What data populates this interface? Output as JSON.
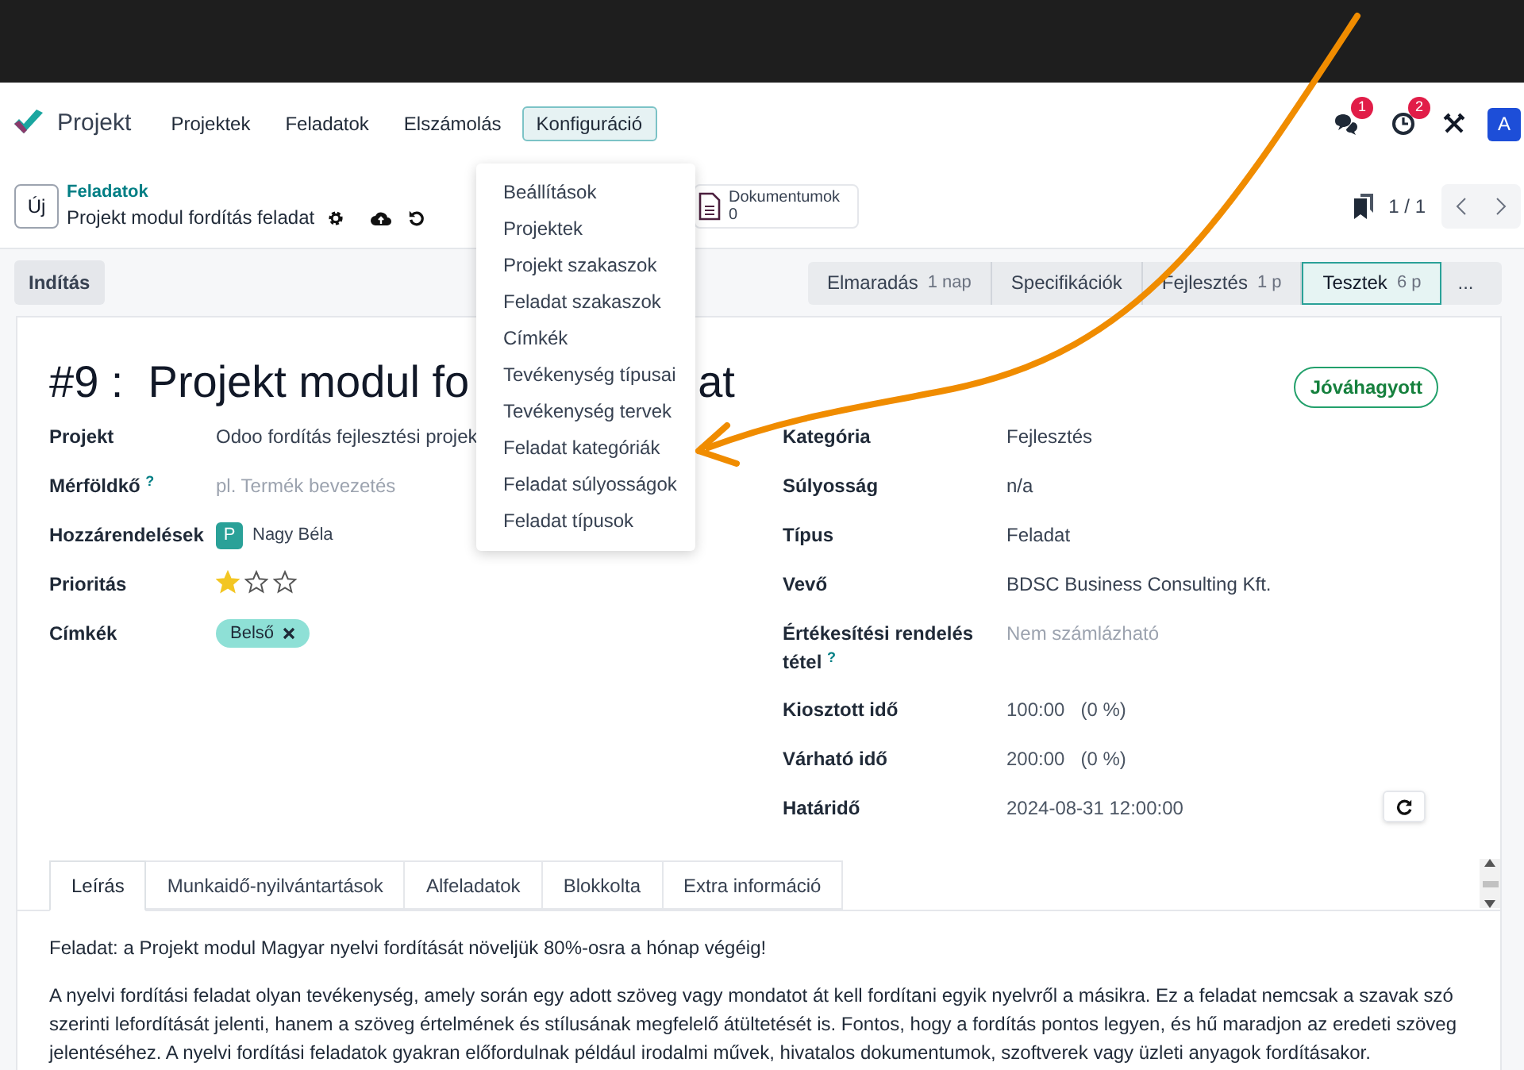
{
  "app": {
    "name": "Projekt"
  },
  "menu": [
    {
      "label": "Projektek",
      "selected": false
    },
    {
      "label": "Feladatok",
      "selected": false
    },
    {
      "label": "Elszámolás",
      "selected": false
    },
    {
      "label": "Konfiguráció",
      "selected": true
    }
  ],
  "dropdown": [
    "Beállítások",
    "Projektek",
    "Projekt szakaszok",
    "Feladat szakaszok",
    "Címkék",
    "Tevékenység típusai",
    "Tevékenység tervek",
    "Feladat kategóriák",
    "Feladat súlyosságok",
    "Feladat típusok"
  ],
  "systray": {
    "messages_badge": "1",
    "activities_badge": "2",
    "avatar": "A"
  },
  "control_panel": {
    "new_button": "Új",
    "breadcrumb": "Feladatok",
    "record": "Projekt modul fordítás feladat",
    "documents_label": "Dokumentumok",
    "documents_count": "0",
    "pager": "1 / 1"
  },
  "action_button": "Indítás",
  "stages": [
    {
      "label": "Elmaradás",
      "duration": "1 nap",
      "selected": false
    },
    {
      "label": "Specifikációk",
      "selected": false
    },
    {
      "label": "Fejlesztés",
      "duration": "1 p",
      "selected": false
    },
    {
      "label": "Tesztek",
      "duration": "6 p",
      "selected": true
    }
  ],
  "stages_more": "...",
  "form": {
    "title_visible": "#9 :  Projekt modul fo",
    "title_tail": "at",
    "state_button": "Jóváhagyott",
    "left_fields": [
      {
        "kind": "text",
        "label": "Projekt",
        "value": "Odoo fordítás fejlesztési projek"
      },
      {
        "kind": "placeholder",
        "label": "Mérföldkő $^{?}$",
        "placeholder": "pl. Termék bevezetés"
      },
      {
        "kind": "user",
        "label": "Hozzárendelések",
        "avatar": "P",
        "value": "Nagy Béla"
      },
      {
        "kind": "stars",
        "label": "Prioritás",
        "stars": 1
      },
      {
        "kind": "tags",
        "label": "Címkék",
        "tags": [
          {
            "label": "Belső",
            "color": "#8ee0d6"
          }
        ]
      }
    ],
    "right_fields": [
      {
        "kind": "text",
        "label": "Kategória",
        "value": "Fejlesztés"
      },
      {
        "kind": "text",
        "label": "Súlyosság",
        "value": "n/a"
      },
      {
        "kind": "text",
        "label": "Típus",
        "value": "Feladat"
      },
      {
        "kind": "text",
        "label": "Vevő",
        "value": "BDSC Business Consulting Kft."
      },
      {
        "kind": "placeholder",
        "label": "Értékesítési rendelés tétel $^{?}$",
        "placeholder": "Nem számlázható"
      },
      {
        "kind": "time",
        "label": "Kiosztott idő",
        "value": "100:00",
        "percent": "(0 %)"
      },
      {
        "kind": "time",
        "label": "Várható idő",
        "value": "200:00",
        "percent": "(0 %)"
      },
      {
        "kind": "date",
        "label": "Határidő",
        "value": "2024-08-31 12:00:00"
      }
    ]
  },
  "tabs": [
    {
      "label": "Leírás",
      "selected": true
    },
    {
      "label": "Munkaidő-nyilvántartások",
      "selected": false
    },
    {
      "label": "Alfeladatok",
      "selected": false
    },
    {
      "label": "Blokkolta",
      "selected": false
    },
    {
      "label": "Extra információ",
      "selected": false
    }
  ],
  "description": [
    "Feladat: a Projekt modul Magyar nyelvi fordítását növeljük 80%-osra a hónap végéig!",
    "A nyelvi fordítási feladat olyan tevékenység, amely során egy adott szöveg vagy mondatot át kell fordítani egyik nyelvről a másikra. Ez a feladat nemcsak a szavak szó szerinti lefordítását jelenti, hanem a szöveg értelmének és stílusának megfelelő átültetését is. Fontos, hogy a fordítás pontos legyen, és hű maradjon az eredeti szöveg jelentéséhez. A nyelvi fordítási feladatok gyakran előfordulnak például irodalmi művek, hivatalos dokumentumok, szoftverek vagy üzleti anyagok fordításakor."
  ]
}
